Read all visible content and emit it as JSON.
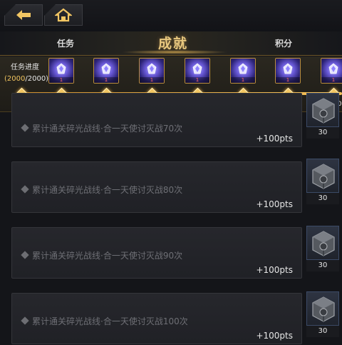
{
  "nav": {
    "back_icon": "back-arrow-icon",
    "home_icon": "home-icon"
  },
  "tabs": [
    {
      "label": "任务",
      "active": false
    },
    {
      "label": "成就",
      "active": true
    },
    {
      "label": "积分",
      "active": false
    }
  ],
  "progress": {
    "label": "任务进度",
    "current": "2000",
    "total": "/2000)",
    "open_paren": "(",
    "milestones": [
      {
        "value": "0"
      },
      {
        "value": "250",
        "reward_qty": "1"
      },
      {
        "value": "500",
        "reward_qty": "1"
      },
      {
        "value": "750",
        "reward_qty": "1"
      },
      {
        "value": "1000",
        "reward_qty": "1"
      },
      {
        "value": "1250",
        "reward_qty": "1"
      },
      {
        "value": "1500",
        "reward_qty": "1"
      },
      {
        "value": "1750",
        "reward_qty": "1"
      }
    ],
    "fill_fraction": 1.0
  },
  "quests": [
    {
      "desc": "累计通关碎光战线·合一天使讨灭战70次",
      "pts": "+100pts",
      "reward_count": "30"
    },
    {
      "desc": "累计通关碎光战线·合一天使讨灭战80次",
      "pts": "+100pts",
      "reward_count": "30"
    },
    {
      "desc": "累计通关碎光战线·合一天使讨灭战90次",
      "pts": "+100pts",
      "reward_count": "30"
    },
    {
      "desc": "累计通关碎光战线·合一天使讨灭战100次",
      "pts": "+100pts",
      "reward_count": "30"
    }
  ],
  "colors": {
    "accent_gold": "#e8c77e",
    "progress_orange": "#f0c460",
    "qty_red": "#ff6a6a"
  }
}
